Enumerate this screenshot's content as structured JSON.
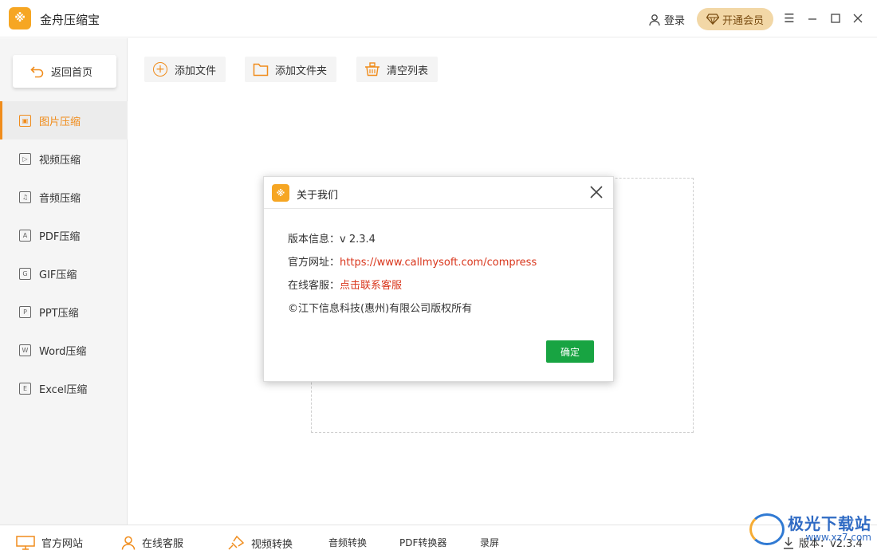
{
  "app": {
    "logo_glyph": "※",
    "title": "金舟压缩宝",
    "login_label": "登录",
    "vip_label": "开通会员",
    "accent": "#f08c1b",
    "vip_bg": "#f2d7a6"
  },
  "sidebar": {
    "home_label": "返回首页",
    "items": [
      {
        "label": "图片压缩",
        "icon": "image-icon",
        "glyph": "▣",
        "active": true
      },
      {
        "label": "视频压缩",
        "icon": "video-icon",
        "glyph": "▷",
        "active": false
      },
      {
        "label": "音频压缩",
        "icon": "audio-icon",
        "glyph": "♫",
        "active": false
      },
      {
        "label": "PDF压缩",
        "icon": "pdf-icon",
        "glyph": "A",
        "active": false
      },
      {
        "label": "GIF压缩",
        "icon": "gif-icon",
        "glyph": "G",
        "active": false
      },
      {
        "label": "PPT压缩",
        "icon": "ppt-icon",
        "glyph": "P",
        "active": false
      },
      {
        "label": "Word压缩",
        "icon": "word-icon",
        "glyph": "W",
        "active": false
      },
      {
        "label": "Excel压缩",
        "icon": "excel-icon",
        "glyph": "E",
        "active": false
      }
    ]
  },
  "toolbar": {
    "add_file": "添加文件",
    "add_folder": "添加文件夹",
    "clear_list": "清空列表"
  },
  "modal": {
    "title": "关于我们",
    "version_label": "版本信息：",
    "version_value": "v 2.3.4",
    "website_label": "官方网址：",
    "website_value": "https://www.callmysoft.com/compress",
    "support_label": "在线客服：",
    "support_value": "点击联系客服",
    "copyright": "©江下信息科技(惠州)有限公司版权所有",
    "ok_label": "确定",
    "link_color": "#d9361c",
    "ok_color": "#18a442"
  },
  "bottombar": {
    "website": "官方网站",
    "support": "在线客服",
    "video_convert": "视频转换",
    "audio_convert": "音频转换",
    "pdf_convert": "PDF转换器",
    "record": "录屏",
    "version": "版本：v2.3.4"
  },
  "watermark": {
    "main": "极光下载站",
    "sub": "www.xz7.com"
  }
}
